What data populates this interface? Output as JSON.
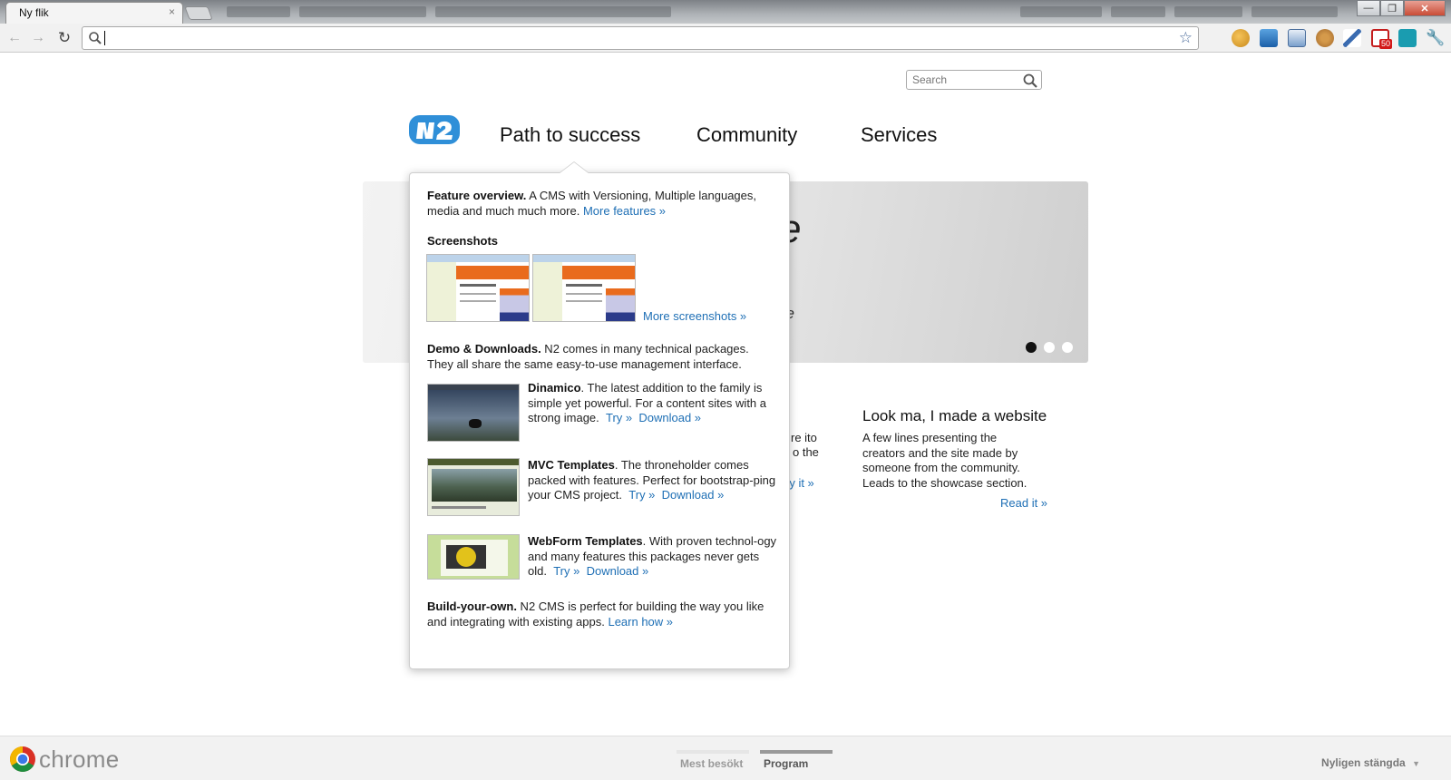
{
  "browser": {
    "tab_title": "Ny flik",
    "tab_close": "×",
    "omnibox_value": "",
    "star_icon": "star-icon"
  },
  "page": {
    "search_placeholder": "Search",
    "nav": [
      "Path to success",
      "Community",
      "Services"
    ],
    "hero": {
      "title_partial": "ode",
      "subtitle_partial": "ce",
      "slides": 3,
      "active_slide": 1
    },
    "columns": {
      "middle_line1": "re ito",
      "middle_line2": "o the",
      "middle_link": "ry it »",
      "right_heading": "Look ma, I made a website",
      "right_text": "A few lines presenting the creators and the site made by someone from the community. Leads to the showcase section.",
      "right_link": "Read it »"
    }
  },
  "popup": {
    "feature_title": "Feature overview.",
    "feature_text": " A CMS with Versioning, Multiple languages, media and much much more. ",
    "feature_link": "More features »",
    "screenshots_title": "Screenshots",
    "screenshots_link": "More screenshots »",
    "demo_title": "Demo & Downloads.",
    "demo_text": " N2 comes in many technical packages. They all share the same easy-to-use management interface.",
    "packages": [
      {
        "name": "Dinamico",
        "text": ". The latest addition to the family is simple yet powerful. For a content sites with a strong image.",
        "try": "Try »",
        "download": "Download »"
      },
      {
        "name": "MVC Templates",
        "text": ". The throneholder comes packed with features. Perfect for bootstrap-ping your CMS project.",
        "try": "Try »",
        "download": "Download »"
      },
      {
        "name": "WebForm Templates",
        "text": ". With proven technol-ogy and many features this packages never gets old.",
        "try": "Try »",
        "download": "Download »"
      }
    ],
    "build_title": "Build-your-own.",
    "build_text": " N2 CMS is perfect for building the way you like and integrating with existing apps. ",
    "build_link": "Learn how »"
  },
  "bottombar": {
    "brand": "chrome",
    "tab_most_visited": "Mest besökt",
    "tab_apps": "Program",
    "recently_closed": "Nyligen stängda"
  }
}
